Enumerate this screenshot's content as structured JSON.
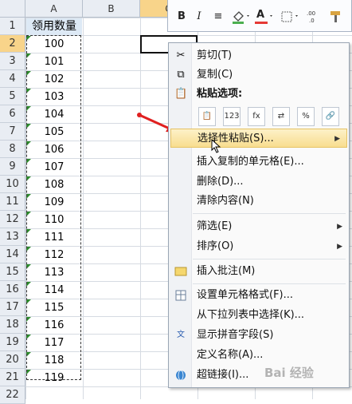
{
  "columns": [
    "A",
    "B",
    "C"
  ],
  "rows": [
    "1",
    "2",
    "3",
    "4",
    "5",
    "6",
    "7",
    "8",
    "9",
    "10",
    "11",
    "12",
    "13",
    "14",
    "15",
    "16",
    "17",
    "18",
    "19",
    "20",
    "21",
    "22"
  ],
  "column_a": {
    "header": "领用数量",
    "values": [
      "100",
      "101",
      "102",
      "103",
      "104",
      "105",
      "106",
      "107",
      "108",
      "109",
      "110",
      "111",
      "112",
      "113",
      "114",
      "115",
      "116",
      "117",
      "118",
      "119"
    ]
  },
  "toolbar": {
    "bold": "B",
    "italic": "I",
    "align": "≡",
    "fill_color": "#4caf50",
    "font_color": "#e53935",
    "font_color_letter": "A"
  },
  "context_menu": {
    "cut": "剪切(T)",
    "copy": "复制(C)",
    "paste_options": "粘贴选项:",
    "paste_buttons": [
      "📋",
      "123",
      "fx",
      "⇄",
      "%",
      "🔗"
    ],
    "paste_special": "选择性粘贴(S)...",
    "insert_copied": "插入复制的单元格(E)...",
    "delete": "删除(D)...",
    "clear": "清除内容(N)",
    "filter": "筛选(E)",
    "sort": "排序(O)",
    "insert_comment": "插入批注(M)",
    "format_cells": "设置单元格格式(F)...",
    "pick_list": "从下拉列表中选择(K)...",
    "phonetic": "显示拼音字段(S)",
    "define_name": "定义名称(A)...",
    "hyperlink": "超链接(I)..."
  },
  "watermark": "Bai 经验",
  "colors": {
    "accent": "#f8d48a",
    "header_fill": "#dde9f5",
    "menu_highlight": "#f8dd8f",
    "arrow": "#e02020"
  }
}
